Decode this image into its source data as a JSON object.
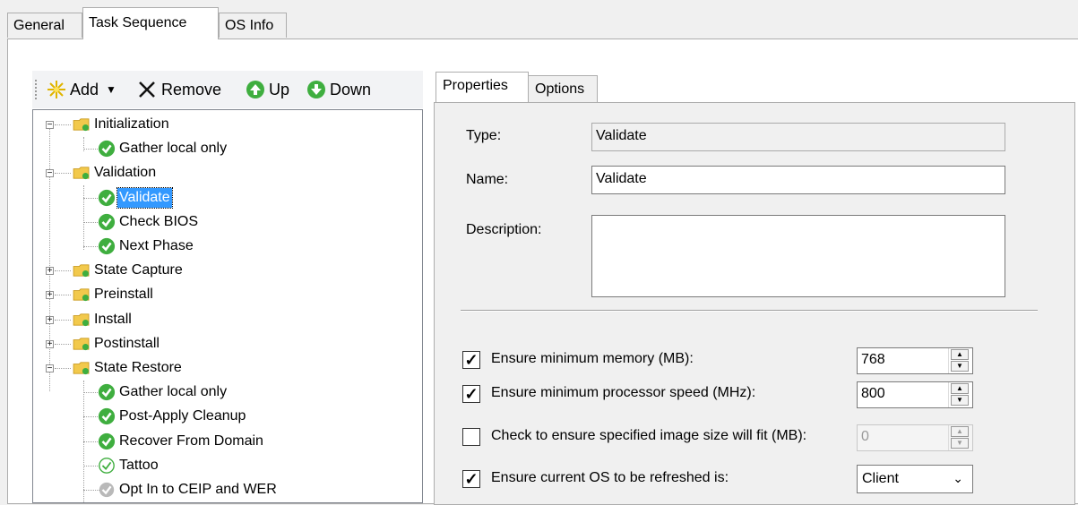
{
  "tabs": [
    "General",
    "Task Sequence",
    "OS Info"
  ],
  "toolbar": {
    "add_label": "Add",
    "remove_label": "Remove",
    "up_label": "Up",
    "down_label": "Down"
  },
  "tree": [
    {
      "label": "Initialization",
      "type": "group"
    },
    {
      "label": "Gather local only",
      "type": "step"
    },
    {
      "label": "Validation",
      "type": "group"
    },
    {
      "label": "Validate",
      "type": "step",
      "selected": true
    },
    {
      "label": "Check BIOS",
      "type": "step"
    },
    {
      "label": "Next Phase",
      "type": "step"
    },
    {
      "label": "State Capture",
      "type": "group"
    },
    {
      "label": "Preinstall",
      "type": "group"
    },
    {
      "label": "Install",
      "type": "group"
    },
    {
      "label": "Postinstall",
      "type": "group"
    },
    {
      "label": "State Restore",
      "type": "group"
    },
    {
      "label": "Gather local only",
      "type": "step"
    },
    {
      "label": "Post-Apply Cleanup",
      "type": "step"
    },
    {
      "label": "Recover From Domain",
      "type": "step"
    },
    {
      "label": "Tattoo",
      "type": "step"
    },
    {
      "label": "Opt In to CEIP and WER",
      "type": "step"
    }
  ],
  "right_tabs": [
    "Properties",
    "Options"
  ],
  "properties": {
    "type_label": "Type:",
    "type_value": "Validate",
    "name_label": "Name:",
    "name_value": "Validate",
    "description_label": "Description:",
    "description_value": ""
  },
  "options": [
    {
      "label": "Ensure minimum memory (MB):",
      "checked": true,
      "value": "768"
    },
    {
      "label": "Ensure minimum processor speed (MHz):",
      "checked": true,
      "value": "800"
    },
    {
      "label": "Check to ensure specified image size will fit (MB):",
      "checked": false,
      "value": "0"
    },
    {
      "label": "Ensure current OS to be refreshed is:",
      "checked": true,
      "value": "Client"
    }
  ],
  "colors": {
    "selection": "#3399ff",
    "check_green": "#3fae3f",
    "folder_yellow": "#f2c94c"
  }
}
